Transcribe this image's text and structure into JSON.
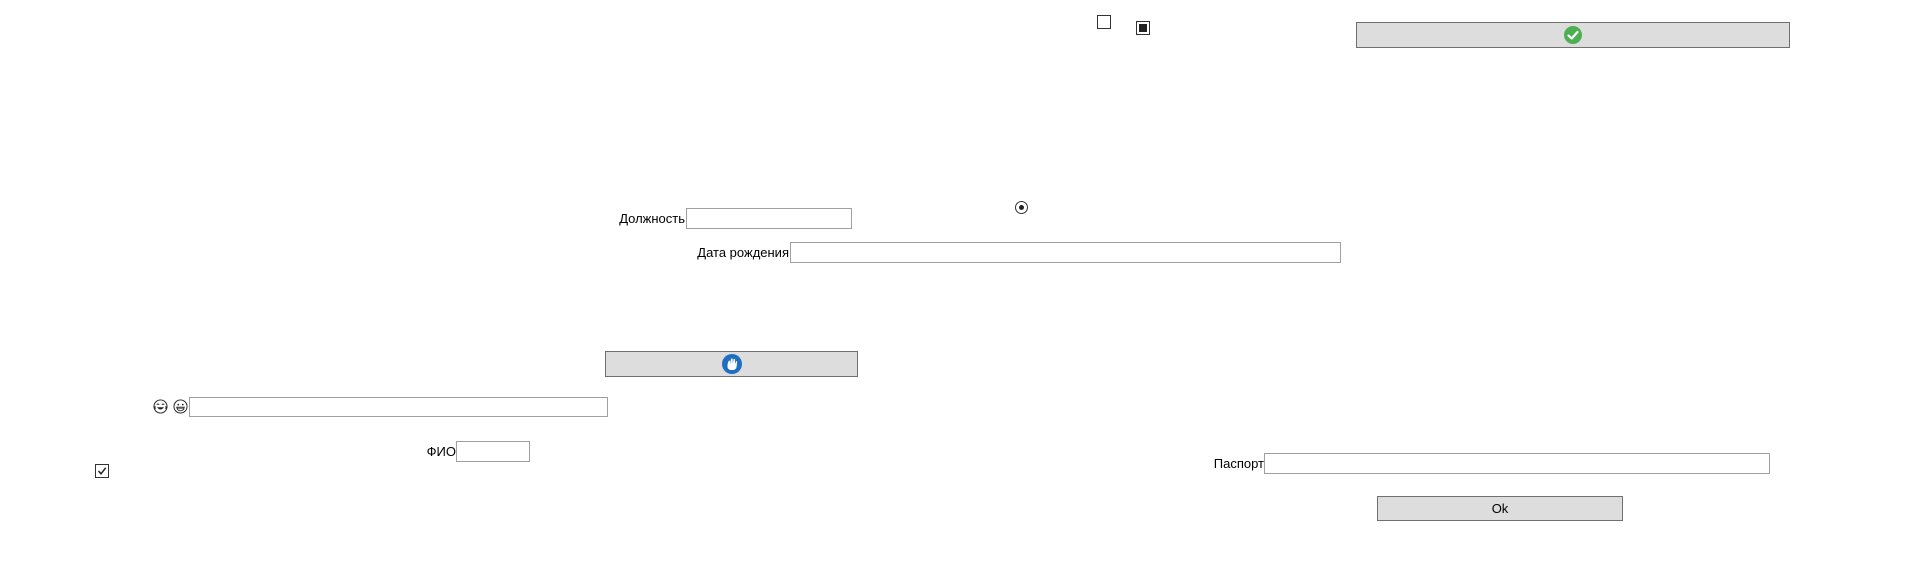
{
  "window": {
    "background": "#ffffff"
  },
  "fields": {
    "position": {
      "label": "Должность",
      "value": "",
      "placeholder": ""
    },
    "birth_date": {
      "label": "Дата рождения",
      "value": "",
      "placeholder": ""
    },
    "emoji_field": {
      "value": "",
      "placeholder": ""
    },
    "full_name": {
      "label": "ФИО",
      "value": "",
      "placeholder": ""
    },
    "passport": {
      "label": "Паспорт",
      "value": "",
      "placeholder": ""
    }
  },
  "buttons": {
    "confirm": {
      "label": "",
      "icon": "check-circle-icon",
      "icon_color": "#4caf50"
    },
    "middle": {
      "label": "",
      "icon": "hand-circle-icon",
      "icon_color": "#1e6fc0"
    },
    "ok": {
      "label": "Ok"
    }
  },
  "checkboxes": {
    "top_unchecked": {
      "checked": false
    },
    "top_indeterminate": {
      "state": "indeterminate"
    },
    "bottom_left_checked": {
      "checked": true
    }
  },
  "radio": {
    "selected": true
  },
  "icons": {
    "emoji_1": "crying-laughing-face-icon",
    "emoji_2": "grinning-face-icon"
  }
}
